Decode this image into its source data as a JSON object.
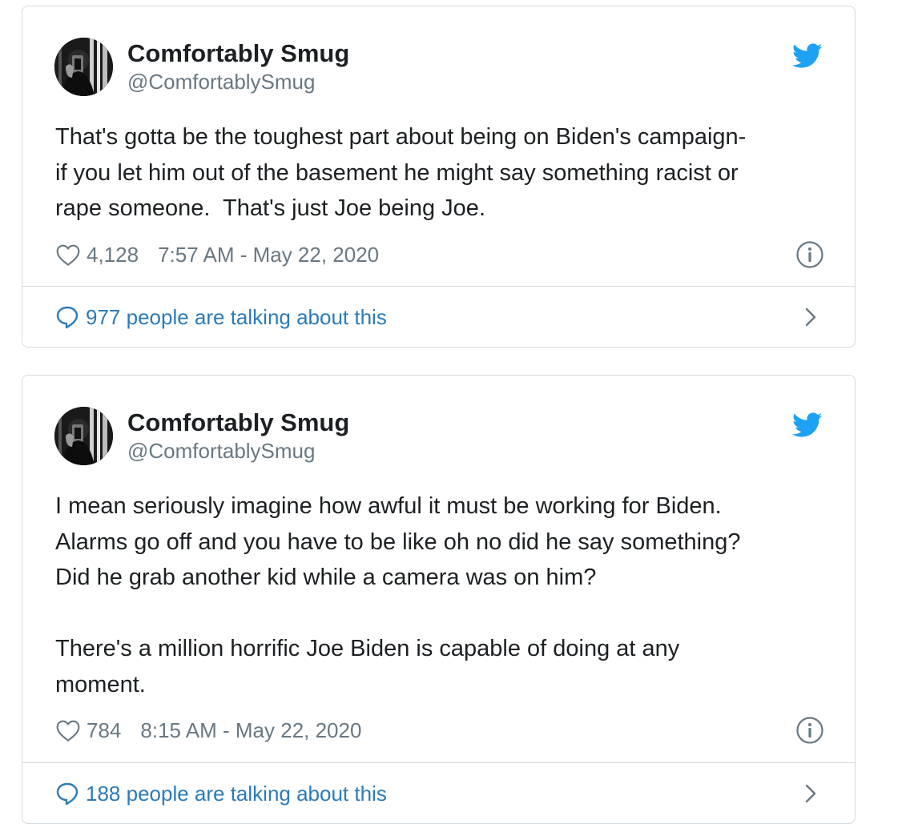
{
  "colors": {
    "link": "#2b7bb9",
    "muted": "#697882",
    "twitter_blue": "#1da1f2",
    "border": "#d3dbe2"
  },
  "tweets": [
    {
      "author_name": "Comfortably Smug",
      "handle": "@ComfortablySmug",
      "text": "That's gotta be the toughest part about being on Biden's campaign-\nif you let him out of the basement he might say something racist or\nrape someone.  That's just Joe being Joe.",
      "likes": "4,128",
      "timestamp": "7:57 AM - May 22, 2020",
      "talking": "977 people are talking about this",
      "icons": [
        "twitter-bird-icon",
        "heart-icon",
        "info-icon",
        "speech-bubble-icon",
        "chevron-right-icon"
      ]
    },
    {
      "author_name": "Comfortably Smug",
      "handle": "@ComfortablySmug",
      "text": "I mean seriously imagine how awful it must be working for Biden.\nAlarms go off and you have to be like oh no did he say something?\nDid he grab another kid while a camera was on him?\n\nThere's a million horrific Joe Biden is capable of doing at any\nmoment.",
      "likes": "784",
      "timestamp": "8:15 AM - May 22, 2020",
      "talking": "188 people are talking about this",
      "icons": [
        "twitter-bird-icon",
        "heart-icon",
        "info-icon",
        "speech-bubble-icon",
        "chevron-right-icon"
      ]
    }
  ]
}
